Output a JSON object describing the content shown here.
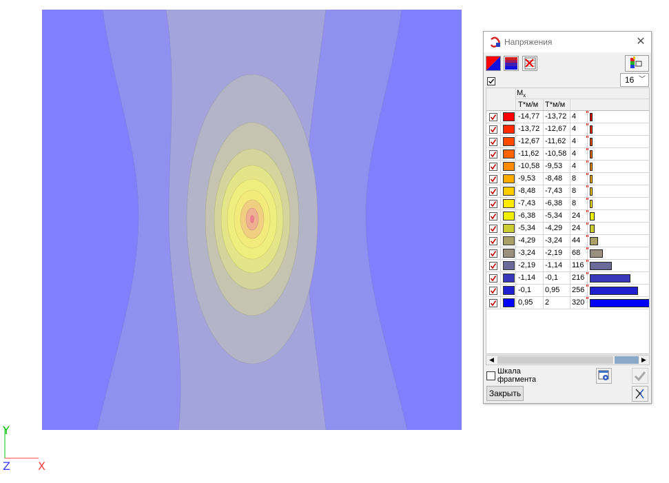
{
  "window": {
    "title": "Напряжения",
    "close_glyph": "✕"
  },
  "toolbar": {
    "icons": [
      "palette-gradient-icon",
      "color-scale-icon",
      "table-delete-icon",
      "legend-layout-icon"
    ]
  },
  "controls": {
    "show_checked": true,
    "count_value": "16"
  },
  "grid": {
    "header": {
      "quantity": "M",
      "quantity_sub": "x",
      "col_from": "Т*м/м",
      "col_to": "Т*м/м"
    },
    "rows": [
      {
        "from": "-14,77",
        "to": "-13,72",
        "count": "4",
        "share": 4,
        "color": "#ff0000",
        "checked": true
      },
      {
        "from": "-13,72",
        "to": "-12,67",
        "count": "4",
        "share": 4,
        "color": "#ff2a00",
        "checked": true
      },
      {
        "from": "-12,67",
        "to": "-11,62",
        "count": "4",
        "share": 4,
        "color": "#ff4a00",
        "checked": true
      },
      {
        "from": "-11,62",
        "to": "-10,58",
        "count": "4",
        "share": 4,
        "color": "#ff6400",
        "checked": true
      },
      {
        "from": "-10,58",
        "to": "-9,53",
        "count": "4",
        "share": 4,
        "color": "#ff8a00",
        "checked": true
      },
      {
        "from": "-9,53",
        "to": "-8,48",
        "count": "8",
        "share": 8,
        "color": "#ffaa00",
        "checked": true
      },
      {
        "from": "-8,48",
        "to": "-7,43",
        "count": "8",
        "share": 8,
        "color": "#ffcc00",
        "checked": true
      },
      {
        "from": "-7,43",
        "to": "-6,38",
        "count": "8",
        "share": 8,
        "color": "#ffea00",
        "checked": true
      },
      {
        "from": "-6,38",
        "to": "-5,34",
        "count": "24",
        "share": 24,
        "color": "#eef000",
        "checked": true
      },
      {
        "from": "-5,34",
        "to": "-4,29",
        "count": "24",
        "share": 24,
        "color": "#cccc33",
        "checked": true
      },
      {
        "from": "-4,29",
        "to": "-3,24",
        "count": "44",
        "share": 44,
        "color": "#a8a066",
        "checked": true
      },
      {
        "from": "-3,24",
        "to": "-2,19",
        "count": "68",
        "share": 68,
        "color": "#999080",
        "checked": true
      },
      {
        "from": "-2,19",
        "to": "-1,14",
        "count": "116",
        "share": 116,
        "color": "#6a6a9a",
        "checked": true
      },
      {
        "from": "-1,14",
        "to": "-0,1",
        "count": "216",
        "share": 216,
        "color": "#3838b8",
        "checked": true
      },
      {
        "from": "-0,1",
        "to": "0,95",
        "count": "256",
        "share": 256,
        "color": "#2020d0",
        "checked": true
      },
      {
        "from": "0,95",
        "to": "2",
        "count": "320",
        "share": 320,
        "color": "#0000ff",
        "checked": true
      }
    ]
  },
  "footer": {
    "scale_label": "Шкала фрагмента",
    "close_label": "Закрыть"
  },
  "axes": {
    "y": "Y",
    "z": "Z",
    "x": "X"
  },
  "colors": {
    "contour_outer": "#8080ff",
    "contour_1": "#9090f0",
    "contour_2": "#a4a4dc",
    "contour_3": "#b4b4c8",
    "contour_4": "#c4c4b0",
    "contour_5": "#d4d49c",
    "contour_6": "#e4e488",
    "contour_7": "#eeee7e",
    "contour_8": "#f2ea7a",
    "contour_9": "#f0d080",
    "contour_10": "#eeb090",
    "contour_11": "#e88090"
  }
}
